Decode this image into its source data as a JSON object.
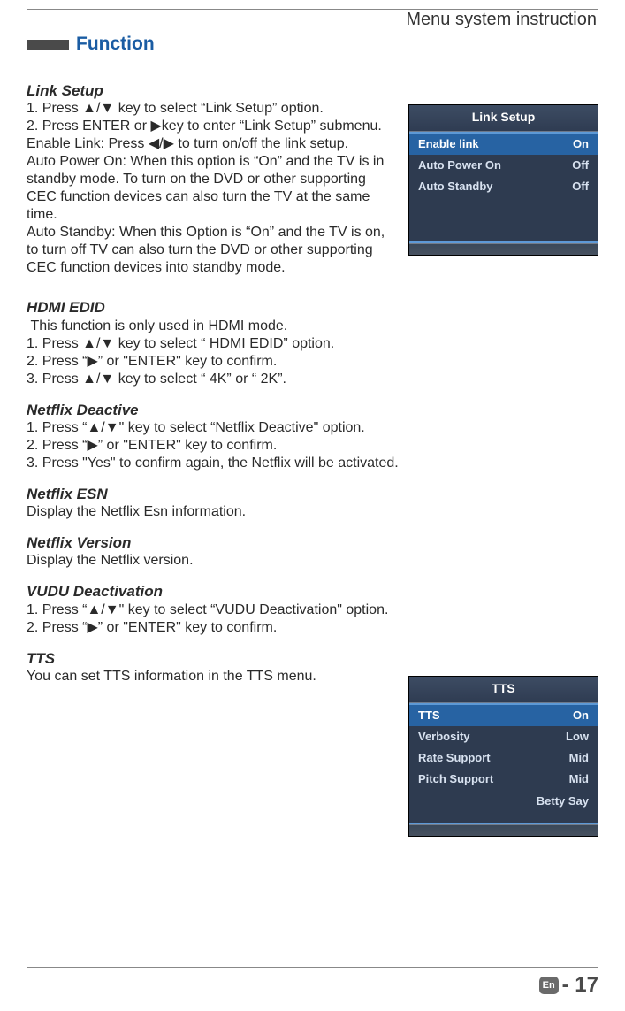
{
  "header": {
    "breadcrumb": "Menu system instruction",
    "title": "Function"
  },
  "sections": {
    "linkSetup": {
      "title": "Link Setup",
      "line1a": "1. Press  ",
      "line1b": " key to select “Link Setup” option.",
      "line2a": "2. Press ENTER or ",
      "line2b": "key to enter “Link Setup” submenu.",
      "line3a": "Enable Link: Press  ",
      "line3b": "    to turn on/off the link setup.",
      "line4": "Auto Power On: When this option is “On” and the TV is in standby mode. To turn on the DVD or other supporting CEC function devices can also turn the TV at the same time.",
      "line5": "Auto Standby: When this Option is “On” and the TV is on, to turn off TV can also turn the DVD or other supporting CEC function devices into standby mode."
    },
    "hdmi": {
      "title": "HDMI EDID",
      "line1": " This function is only used in HDMI mode.",
      "line2a": "1. Press  ",
      "line2b": " key to select “ HDMI EDID” option.",
      "line3a": "2. Press “",
      "line3b": "” or \"ENTER\" key to confirm.",
      "line4a": "3. Press  ",
      "line4b": " key to select “ 4K” or “ 2K”."
    },
    "netflixDeactive": {
      "title": "Netflix Deactive",
      "line1a": "1. Press “",
      "line1b": "\" key to select “Netflix Deactive\" option.",
      "line2a": "2. Press “",
      "line2b": "” or \"ENTER\" key to confirm.",
      "line3": "3. Press \"Yes\" to confirm again, the Netflix will be activated."
    },
    "netflixEsn": {
      "title": "Netflix ESN",
      "line1": "Display the Netflix Esn information."
    },
    "netflixVersion": {
      "title": "Netflix Version",
      "line1": "Display the Netflix version."
    },
    "vudu": {
      "title": "VUDU Deactivation",
      "line1a": "1. Press “",
      "line1b": "\" key to select “VUDU Deactivation\" option.",
      "line2a": "2. Press “",
      "line2b": "” or \"ENTER\" key to confirm."
    },
    "tts": {
      "title": "TTS",
      "line1": "You can set TTS information in the TTS menu."
    }
  },
  "glyphs": {
    "updown": "▲/▼",
    "right": "▶",
    "leftright": "◀/▶"
  },
  "osdLink": {
    "title": "Link Setup",
    "rows": [
      {
        "label": "Enable link",
        "value": "On"
      },
      {
        "label": "Auto Power On",
        "value": "Off"
      },
      {
        "label": "Auto Standby",
        "value": "Off"
      }
    ]
  },
  "osdTts": {
    "title": "TTS",
    "rows": [
      {
        "label": "TTS",
        "value": "On"
      },
      {
        "label": "Verbosity",
        "value": "Low"
      },
      {
        "label": "Rate Support",
        "value": "Mid"
      },
      {
        "label": "Pitch Support",
        "value": "Mid"
      }
    ],
    "footer": "Betty Say"
  },
  "footer": {
    "lang": "En",
    "page": " - 17"
  }
}
